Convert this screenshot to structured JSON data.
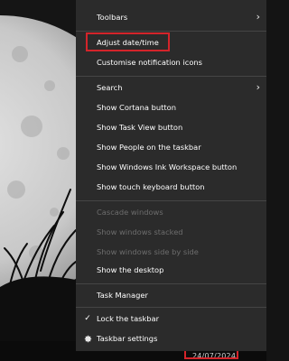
{
  "context_menu": {
    "items": [
      {
        "label": "Toolbars",
        "has_submenu": true,
        "disabled": false
      },
      {
        "label": "Adjust date/time",
        "disabled": false,
        "highlighted": true
      },
      {
        "label": "Customise notification icons",
        "disabled": false
      },
      {
        "label": "Search",
        "has_submenu": true,
        "disabled": false
      },
      {
        "label": "Show Cortana button",
        "disabled": false
      },
      {
        "label": "Show Task View button",
        "disabled": false
      },
      {
        "label": "Show People on the taskbar",
        "disabled": false
      },
      {
        "label": "Show Windows Ink Workspace button",
        "disabled": false
      },
      {
        "label": "Show touch keyboard button",
        "disabled": false
      },
      {
        "label": "Cascade windows",
        "disabled": true
      },
      {
        "label": "Show windows stacked",
        "disabled": true
      },
      {
        "label": "Show windows side by side",
        "disabled": true
      },
      {
        "label": "Show the desktop",
        "disabled": false
      },
      {
        "label": "Task Manager",
        "disabled": false
      },
      {
        "label": "Lock the taskbar",
        "checked": true,
        "disabled": false
      },
      {
        "label": "Taskbar settings",
        "icon": "gear-icon",
        "disabled": false
      }
    ],
    "submenu_arrow": "›",
    "checkmark": "✓"
  },
  "taskbar": {
    "date": "24/07/2024",
    "date_highlighted": true
  },
  "colors": {
    "menu_bg": "#2b2b2b",
    "highlight_border": "#d4242a",
    "disabled_text": "#6d6d6d"
  }
}
